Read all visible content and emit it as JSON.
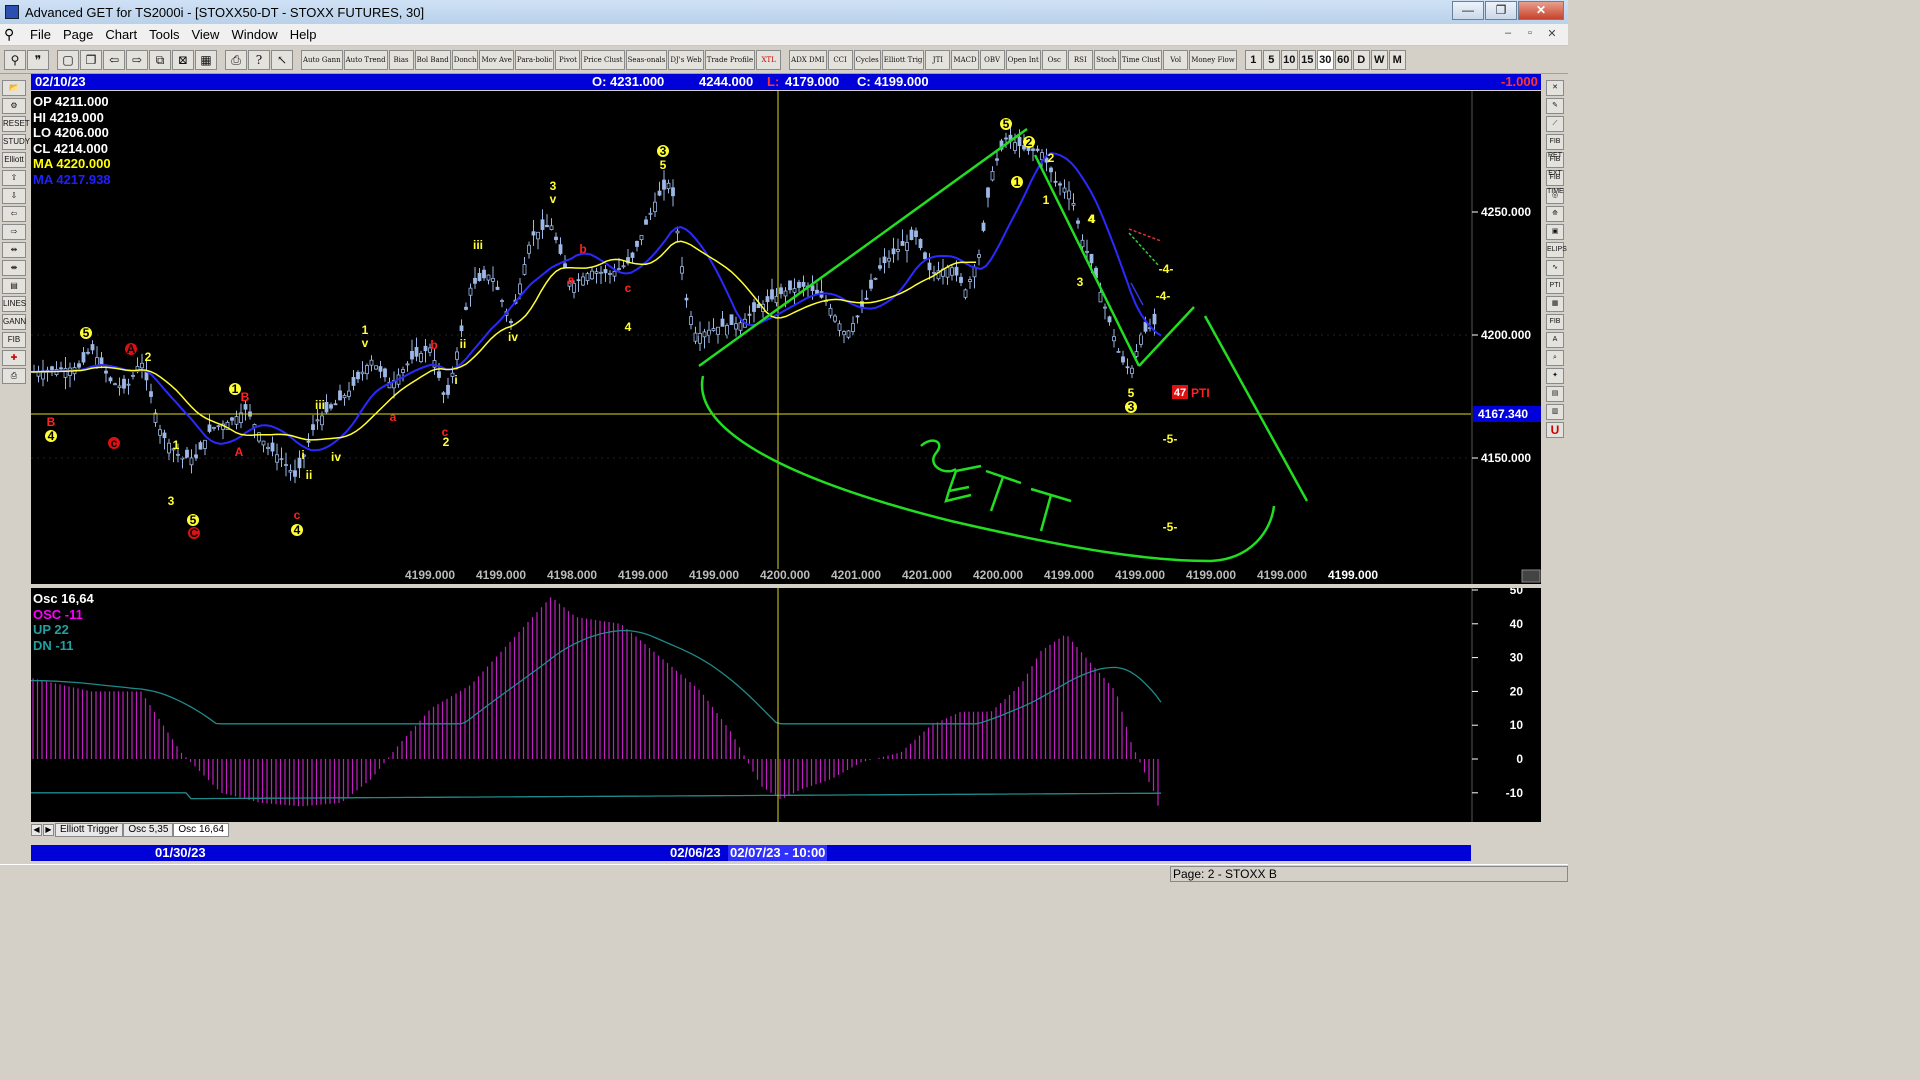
{
  "window": {
    "title": "Advanced GET for TS2000i - [STOXX50-DT - STOXX FUTURES, 30]",
    "buttons": {
      "minimize": "—",
      "maximize": "❐",
      "close": "✕"
    }
  },
  "menu": {
    "items": [
      "File",
      "Page",
      "Chart",
      "Tools",
      "View",
      "Window",
      "Help"
    ]
  },
  "toolbar": {
    "study_buttons": [
      "Auto Gann",
      "Auto Trend",
      "Bias",
      "Bol Band",
      "Donch",
      "Mov Ave",
      "Para-bolic",
      "Pivot",
      "Price Clust",
      "Seas-onals",
      "DJ's Web",
      "Trade Profile",
      "XTL",
      "ADX DMI",
      "CCI",
      "Cycles",
      "Elliott Trig",
      "JTI",
      "MACD",
      "OBV",
      "Open Int",
      "Osc",
      "RSI",
      "Stoch",
      "Time Clust",
      "Vol",
      "Money Flow"
    ],
    "intervals": [
      "1",
      "5",
      "10",
      "15",
      "30",
      "60",
      "D",
      "W",
      "M"
    ],
    "active_interval": "30"
  },
  "left_tools": [
    "open",
    "gear",
    "RESET",
    "STUDY",
    "Elliott",
    "up-arrow",
    "down-arrow",
    "left-arrow",
    "right-arrow",
    "zoom-in",
    "zoom-out",
    "page",
    "LINES",
    "GANN",
    "FIB",
    "cross",
    "print"
  ],
  "right_tools": [
    "✕",
    "pencil",
    "ruler",
    "FIB RET",
    "FIB EXT",
    "FIB TIME",
    "circle",
    "fan",
    "square",
    "ELIPS",
    "wave",
    "PTI",
    "grid",
    "FIB",
    "A",
    "zoom",
    "paint",
    "grid2",
    "calc",
    "U"
  ],
  "info_bar": {
    "date": "02/10/23",
    "open": "O: 4231.000",
    "high": "4244.000",
    "low_label": "L:",
    "low": "4179.000",
    "close": "C: 4199.000",
    "change": "-1.000"
  },
  "price_legend": [
    {
      "label": "OP",
      "value": "4211.000",
      "color": "#ffffff"
    },
    {
      "label": "HI",
      "value": "4219.000",
      "color": "#ffffff"
    },
    {
      "label": "LO",
      "value": "4206.000",
      "color": "#ffffff"
    },
    {
      "label": "CL",
      "value": "4214.000",
      "color": "#ffffff"
    },
    {
      "label": "MA",
      "value": "4220.000",
      "color": "#ffff00"
    },
    {
      "label": "MA",
      "value": "4217.938",
      "color": "#2020ff"
    }
  ],
  "price_axis": {
    "ticks": [
      "4250.000",
      "4200.000",
      "4150.000"
    ],
    "current_price": "4167.340"
  },
  "bottom_values": [
    "4199.000",
    "4199.000",
    "4198.000",
    "4199.000",
    "4199.000",
    "4200.000",
    "4201.000",
    "4201.000",
    "4200.000",
    "4199.000",
    "4199.000",
    "4199.000",
    "4199.000",
    "4199.000"
  ],
  "elliott_labels": {
    "yellow": [
      "5",
      "4",
      "1",
      "4",
      "3",
      "5",
      "1",
      "2",
      "i",
      "ii",
      "iii",
      "iv",
      "1",
      "v",
      "i",
      "2",
      "iii",
      "ii",
      "iv",
      "3",
      "v",
      "4",
      "3",
      "5",
      "4",
      "5",
      "1",
      "2",
      "2",
      "1",
      "4",
      "3",
      "5",
      "3",
      "-4-",
      "-4-",
      "-5-",
      "-5-"
    ],
    "red": [
      "B",
      "A",
      "c",
      "B",
      "A",
      "C",
      "c",
      "a",
      "b",
      "c",
      "a",
      "b",
      "c",
      "PTI"
    ],
    "pti_count": "47",
    "annotation": "SETT"
  },
  "osc_legend": [
    {
      "label": "Osc 16,64",
      "color": "#ffffff"
    },
    {
      "label": "OSC -11",
      "color": "#ff00ff"
    },
    {
      "label": "UP   22",
      "color": "#20a0a0"
    },
    {
      "label": "DN   -11",
      "color": "#20a0a0"
    }
  ],
  "osc_axis": {
    "ticks": [
      "50",
      "40",
      "30",
      "20",
      "10",
      "0",
      "-10"
    ]
  },
  "tabs": [
    "Elliott Trigger",
    "Osc 5,35",
    "Osc 16,64"
  ],
  "active_tab": "Osc 16,64",
  "date_bar": {
    "left_date": "01/30/23",
    "mid_date": "02/06/23",
    "cursor_date": "02/07/23 - 10:00"
  },
  "status": {
    "page": "Page: 2 - STOXX B"
  },
  "colors": {
    "info_bar_bg": "#0000d8",
    "candle": "#9db8e6",
    "ma_fast": "#ffff33",
    "ma_slow": "#2a2aff",
    "annotation": "#22dd22",
    "osc_histogram": "#c020c0",
    "osc_band": "#208a8a"
  }
}
